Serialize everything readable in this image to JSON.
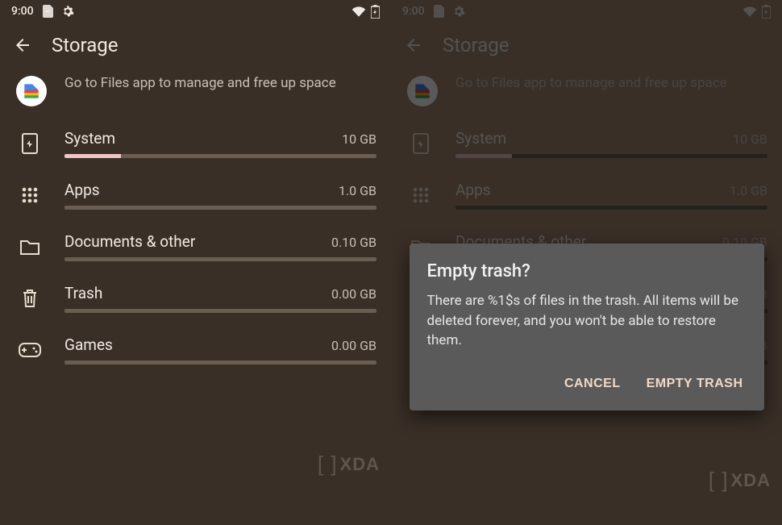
{
  "status": {
    "time": "9:00",
    "icons_left": [
      "no-sim-icon",
      "gear-icon"
    ],
    "icons_right": [
      "wifi-icon",
      "battery-icon"
    ]
  },
  "header": {
    "title": "Storage"
  },
  "files_hint": {
    "text": "Go to Files app to manage and free up space"
  },
  "categories": [
    {
      "icon": "system-icon",
      "name": "System",
      "size": "10 GB",
      "fill_pct": 18
    },
    {
      "icon": "apps-icon",
      "name": "Apps",
      "size": "1.0 GB",
      "fill_pct": 0
    },
    {
      "icon": "folder-icon",
      "name": "Documents & other",
      "size": "0.10 GB",
      "fill_pct": 0
    },
    {
      "icon": "trash-icon",
      "name": "Trash",
      "size": "0.00 GB",
      "fill_pct": 0
    },
    {
      "icon": "games-icon",
      "name": "Games",
      "size": "0.00 GB",
      "fill_pct": 0
    }
  ],
  "dialog": {
    "title": "Empty trash?",
    "body": "There are %1$s of files in the trash. All items will be deleted forever, and you won't be able to restore them.",
    "cancel": "CANCEL",
    "confirm": "EMPTY TRASH"
  },
  "watermark": "XDA"
}
